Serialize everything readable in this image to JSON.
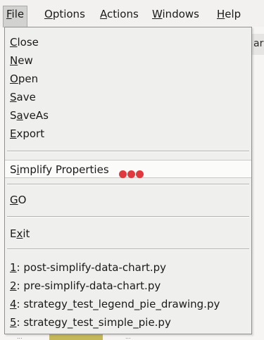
{
  "menubar": {
    "items": [
      {
        "pre": "",
        "mn": "F",
        "post": "ile"
      },
      {
        "pre": "",
        "mn": "O",
        "post": "ptions"
      },
      {
        "pre": "",
        "mn": "A",
        "post": "ctions"
      },
      {
        "pre": "",
        "mn": "W",
        "post": "indows"
      },
      {
        "pre": "",
        "mn": "H",
        "post": "elp"
      }
    ]
  },
  "background": {
    "window_label": "ar",
    "bottom_left": "...",
    "bottom_right": "..."
  },
  "file_menu": {
    "items": [
      {
        "pre": "",
        "mn": "C",
        "post": "lose"
      },
      {
        "pre": "",
        "mn": "N",
        "post": "ew"
      },
      {
        "pre": "",
        "mn": "O",
        "post": "pen"
      },
      {
        "pre": "",
        "mn": "S",
        "post": "ave"
      },
      {
        "pre": "S",
        "mn": "a",
        "post": "veAs"
      },
      {
        "pre": "",
        "mn": "E",
        "post": "xport"
      },
      {
        "pre": "S",
        "mn": "i",
        "post": "mplify Properties"
      },
      {
        "pre": "",
        "mn": "G",
        "post": "O"
      },
      {
        "pre": "E",
        "mn": "x",
        "post": "it"
      },
      {
        "pre": "",
        "mn": "1",
        "post": ": post-simplify-data-chart.py"
      },
      {
        "pre": "",
        "mn": "2",
        "post": ": pre-simplify-data-chart.py"
      },
      {
        "pre": "",
        "mn": "4",
        "post": ": strategy_test_legend_pie_drawing.py"
      },
      {
        "pre": "",
        "mn": "5",
        "post": ": strategy_test_simple_pie.py"
      }
    ],
    "indicator_color": "#e0383e"
  }
}
